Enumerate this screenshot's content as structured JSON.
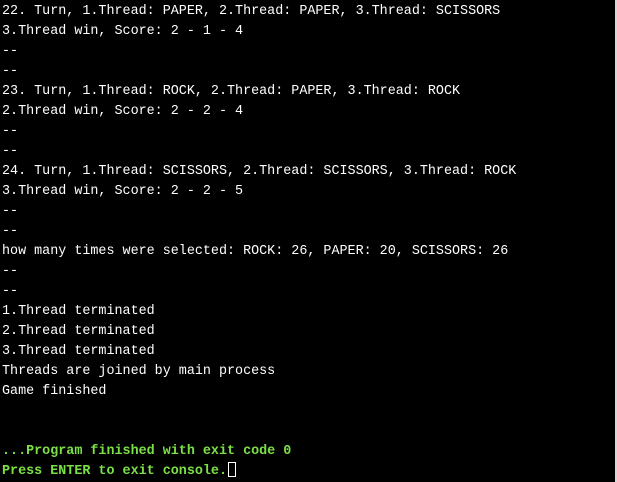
{
  "console": {
    "lines": [
      {
        "text": "22. Turn, 1.Thread: PAPER, 2.Thread: PAPER, 3.Thread: SCISSORS",
        "name": "output-line-turn-22"
      },
      {
        "text": "3.Thread win, Score: 2 - 1 - 4",
        "name": "output-line-result-22"
      },
      {
        "text": "--",
        "name": "output-line-separator"
      },
      {
        "text": "--",
        "name": "output-line-separator"
      },
      {
        "text": "23. Turn, 1.Thread: ROCK, 2.Thread: PAPER, 3.Thread: ROCK",
        "name": "output-line-turn-23"
      },
      {
        "text": "2.Thread win, Score: 2 - 2 - 4",
        "name": "output-line-result-23"
      },
      {
        "text": "--",
        "name": "output-line-separator"
      },
      {
        "text": "--",
        "name": "output-line-separator"
      },
      {
        "text": "24. Turn, 1.Thread: SCISSORS, 2.Thread: SCISSORS, 3.Thread: ROCK",
        "name": "output-line-turn-24"
      },
      {
        "text": "3.Thread win, Score: 2 - 2 - 5",
        "name": "output-line-result-24"
      },
      {
        "text": "--",
        "name": "output-line-separator"
      },
      {
        "text": "--",
        "name": "output-line-separator"
      },
      {
        "text": "how many times were selected: ROCK: 26, PAPER: 20, SCISSORS: 26",
        "name": "output-line-selection-summary"
      },
      {
        "text": "--",
        "name": "output-line-separator"
      },
      {
        "text": "--",
        "name": "output-line-separator"
      },
      {
        "text": "1.Thread terminated",
        "name": "output-line-thread-1-terminated"
      },
      {
        "text": "2.Thread terminated",
        "name": "output-line-thread-2-terminated"
      },
      {
        "text": "3.Thread terminated",
        "name": "output-line-thread-3-terminated"
      },
      {
        "text": "Threads are joined by main process",
        "name": "output-line-threads-joined"
      },
      {
        "text": "Game finished",
        "name": "output-line-game-finished"
      }
    ],
    "exit_message": "...Program finished with exit code 0",
    "prompt": "Press ENTER to exit console."
  },
  "colors": {
    "background": "#000000",
    "text": "#ffffff",
    "status_text": "#7be046"
  }
}
